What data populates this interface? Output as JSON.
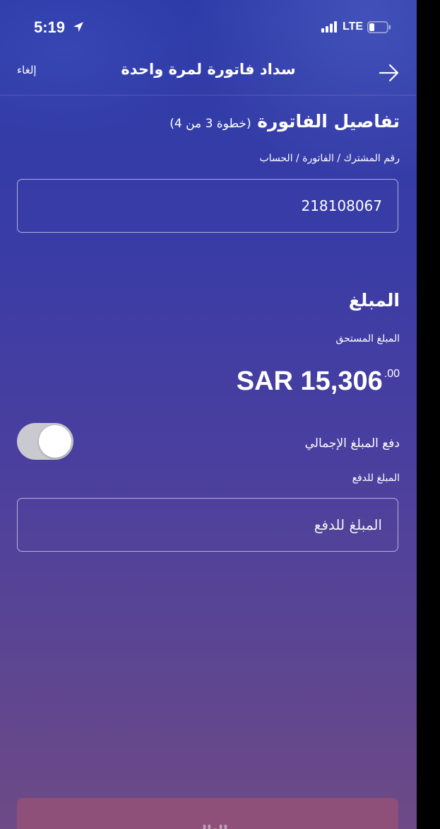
{
  "status_bar": {
    "time": "5:19",
    "network": "LTE",
    "icons": [
      "location-arrow-icon",
      "signal-bars-icon",
      "battery-icon"
    ]
  },
  "nav": {
    "cancel_label": "إلغاء",
    "title": "سداد فاتورة لمرة واحدة",
    "back_icon": "arrow-right-icon"
  },
  "bill_details": {
    "title": "تفاصيل الفاتورة",
    "step": "(خطوة 3 من 4)",
    "account_label": "رقم المشترك / الفاتورة / الحساب",
    "account_value": "218108067"
  },
  "amount": {
    "title": "المبلغ",
    "due_label": "المبلغ المستحق",
    "due_value": "SAR 15,306",
    "due_decimal": ".00",
    "pay_total_label": "دفع المبلغ الإجمالي",
    "pay_total_on": true,
    "pay_amount_label": "المبلغ للدفع",
    "pay_amount_placeholder": "المبلغ للدفع",
    "pay_amount_value": ""
  },
  "footer": {
    "next_label": "التالي"
  },
  "colors": {
    "bg_top": "#2c3ba8",
    "bg_bottom": "#6e4a86",
    "button_disabled": "#8e4f78",
    "toggle_track": "#c9c9cf"
  }
}
